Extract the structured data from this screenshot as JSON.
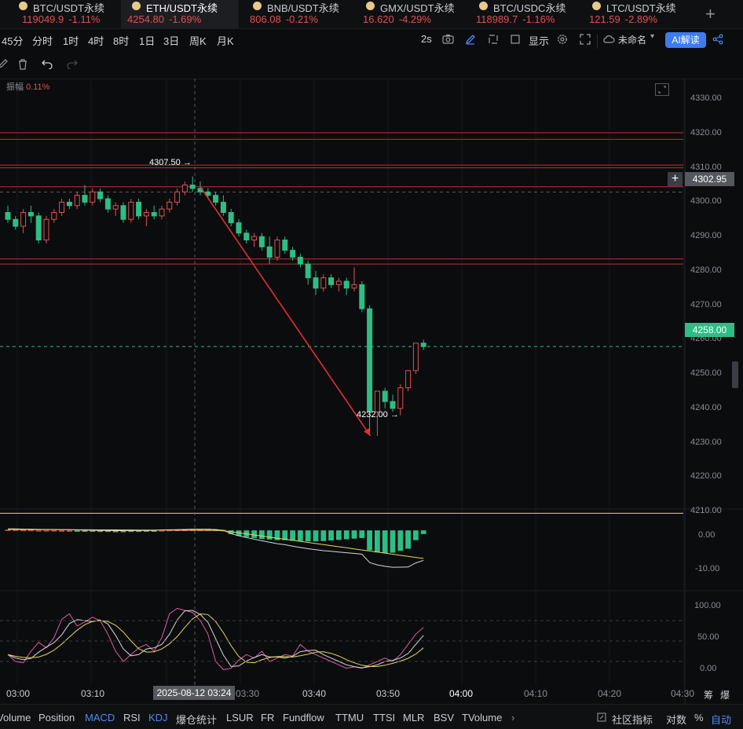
{
  "tabs": [
    {
      "name": "BTC/USDT永续",
      "price": "119049.9",
      "change": "-1.11%"
    },
    {
      "name": "ETH/USDT永续",
      "price": "4254.80",
      "change": "-1.69%"
    },
    {
      "name": "BNB/USDT永续",
      "price": "806.08",
      "change": "-0.21%"
    },
    {
      "name": "GMX/USDT永续",
      "price": "16.620",
      "change": "-4.29%"
    },
    {
      "name": "BTC/USDC永续",
      "price": "118989.7",
      "change": "-1.16%"
    },
    {
      "name": "LTC/USDT永续",
      "price": "121.59",
      "change": "-2.89%"
    }
  ],
  "add_tab": "+",
  "intervals": [
    "45分",
    "分时",
    "1时",
    "4时",
    "8时",
    "1日",
    "3日",
    "周K",
    "月K"
  ],
  "toolbar": {
    "refresh": "2s",
    "display": "显示",
    "layout_name": "未命名",
    "ai_label": "AI解读"
  },
  "amplitude": {
    "label": "振幅",
    "value": "0.11%"
  },
  "price_axis": [
    "4330.00",
    "4320.00",
    "4310.00",
    "4300.00",
    "4290.00",
    "4280.00",
    "4270.00",
    "4260.00",
    "4250.00",
    "4240.00",
    "4230.00",
    "4220.00",
    "4210.00"
  ],
  "crosshair_price": "4302.95",
  "last_price": "4258.00",
  "high_marker": "4307.50",
  "low_marker": "4232.00",
  "macd_axis": [
    "0.00",
    "-10.00"
  ],
  "kdj_axis": [
    "100.00",
    "50.00",
    "0.00"
  ],
  "time_axis": [
    "03:00",
    "03:10",
    "03:30",
    "03:40",
    "03:50",
    "04:00",
    "04:10",
    "04:20",
    "04:30"
  ],
  "crosshair_time": "2025-08-12 03:24",
  "time_axis_right": [
    "筹",
    "爆"
  ],
  "indicators": [
    "Volume",
    "Position",
    "MACD",
    "RSI",
    "KDJ",
    "爆仓统计",
    "LSUR",
    "FR",
    "Fundflow",
    "TTMU",
    "TTSI",
    "MLR",
    "BSV",
    "TVolume"
  ],
  "active_indicators": [
    "MACD",
    "KDJ"
  ],
  "bottom_right": {
    "community": "社区指标",
    "log": "对数",
    "percent": "%",
    "auto": "自动"
  },
  "colors": {
    "up": "#e2504f",
    "down": "#2ebd85",
    "accent": "#4a8cf7",
    "yellow": "#e6d75a"
  },
  "chart_data": {
    "type": "candlestick",
    "y_range": [
      4205,
      4333
    ],
    "candles": [
      [
        4297,
        4299,
        4294,
        4295
      ],
      [
        4295,
        4296,
        4292,
        4293
      ],
      [
        4293,
        4298,
        4291,
        4297
      ],
      [
        4297,
        4299,
        4294,
        4296
      ],
      [
        4296,
        4297,
        4288,
        4289
      ],
      [
        4289,
        4296,
        4288,
        4295
      ],
      [
        4295,
        4298,
        4294,
        4297
      ],
      [
        4297,
        4301,
        4296,
        4300
      ],
      [
        4300,
        4301,
        4298,
        4299
      ],
      [
        4299,
        4303,
        4298,
        4302
      ],
      [
        4302,
        4305,
        4299,
        4300
      ],
      [
        4300,
        4304,
        4299,
        4303
      ],
      [
        4303,
        4304,
        4300,
        4301
      ],
      [
        4301,
        4302,
        4297,
        4298
      ],
      [
        4298,
        4300,
        4296,
        4299
      ],
      [
        4299,
        4300,
        4294,
        4295
      ],
      [
        4295,
        4301,
        4294,
        4300
      ],
      [
        4300,
        4301,
        4295,
        4296
      ],
      [
        4296,
        4298,
        4293,
        4297
      ],
      [
        4297,
        4299,
        4295,
        4296
      ],
      [
        4296,
        4299,
        4295,
        4298
      ],
      [
        4298,
        4301,
        4297,
        4300
      ],
      [
        4300,
        4304,
        4299,
        4303
      ],
      [
        4303,
        4306,
        4302,
        4305
      ],
      [
        4305,
        4307.5,
        4303,
        4304
      ],
      [
        4304,
        4306,
        4302,
        4303
      ],
      [
        4303,
        4304,
        4301,
        4302
      ],
      [
        4302,
        4303,
        4299,
        4300
      ],
      [
        4300,
        4302,
        4296,
        4297
      ],
      [
        4297,
        4298,
        4293,
        4294
      ],
      [
        4294,
        4295,
        4290,
        4291
      ],
      [
        4291,
        4292,
        4288,
        4289
      ],
      [
        4289,
        4291,
        4287,
        4290
      ],
      [
        4290,
        4291,
        4286,
        4287
      ],
      [
        4287,
        4290,
        4282,
        4284
      ],
      [
        4284,
        4290,
        4283,
        4289
      ],
      [
        4289,
        4290,
        4285,
        4286
      ],
      [
        4286,
        4287,
        4283,
        4284
      ],
      [
        4284,
        4285,
        4281,
        4282
      ],
      [
        4282,
        4283,
        4276,
        4278
      ],
      [
        4278,
        4280,
        4273,
        4275
      ],
      [
        4275,
        4279,
        4274,
        4278
      ],
      [
        4278,
        4279,
        4275,
        4276
      ],
      [
        4276,
        4278,
        4274,
        4277
      ],
      [
        4277,
        4278,
        4273,
        4275
      ],
      [
        4275,
        4281,
        4274,
        4276
      ],
      [
        4276,
        4277,
        4268,
        4269
      ],
      [
        4269,
        4270,
        4233,
        4239
      ],
      [
        4239,
        4245,
        4232,
        4245
      ],
      [
        4245,
        4246,
        4240,
        4242
      ],
      [
        4242,
        4244,
        4239,
        4240
      ],
      [
        4240,
        4247,
        4238,
        4246
      ],
      [
        4246,
        4251,
        4245,
        4251
      ],
      [
        4251,
        4259,
        4250,
        4259
      ],
      [
        4259,
        4260,
        4257,
        4258
      ]
    ],
    "horizontal_lines": [
      4320.2,
      4318.3,
      4310.8,
      4310.0,
      4304.5,
      4283.5,
      4282.0,
      4209.5
    ],
    "trend_arrow": {
      "from": [
        4304.5
      ],
      "to": [
        4232
      ]
    },
    "macd": {
      "range": [
        -14,
        4
      ],
      "hist": [
        0.3,
        0.3,
        0.2,
        0.2,
        0.1,
        0.1,
        0.1,
        0,
        0,
        -0.1,
        -0.2,
        -0.2,
        -0.3,
        -0.3,
        -0.4,
        -0.4,
        -0.3,
        -0.3,
        -0.2,
        -0.2,
        0.1,
        0.2,
        0.3,
        0.4,
        0.5,
        0.5,
        0.5,
        0.4,
        0.2,
        -1.0,
        -1.6,
        -2.0,
        -2.3,
        -2.6,
        -2.8,
        -3.0,
        -3.0,
        -3.2,
        -3.3,
        -3.4,
        -3.4,
        -3.3,
        -3.1,
        -2.9,
        -2.7,
        -2.5,
        -2.3,
        -6.3,
        -7.0,
        -7.2,
        -7.1,
        -6.5,
        -5.8,
        -3.0,
        -1.0
      ]
    },
    "kdj": {
      "range": [
        -10,
        110
      ]
    }
  }
}
